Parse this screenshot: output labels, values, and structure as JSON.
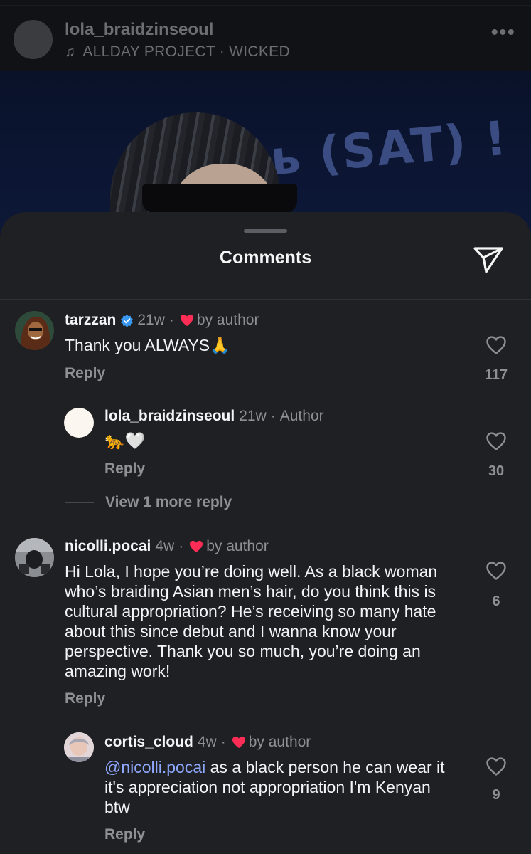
{
  "post": {
    "username": "lola_braidzinseoul",
    "music": "ALLDAY PROJECT · WICKED",
    "image_overlay_text": "ь (SAT) !"
  },
  "sheet": {
    "title": "Comments"
  },
  "comments": [
    {
      "username": "tarzzan",
      "verified": true,
      "time": "21w",
      "separator": "·",
      "liked_by": "by author",
      "text": "Thank you ALWAYS🙏",
      "reply": "Reply",
      "likes": "117",
      "replies": [
        {
          "username": "lola_braidzinseoul",
          "time": "21w",
          "separator": "·",
          "badge": "Author",
          "text": "🐆🤍",
          "reply": "Reply",
          "likes": "30"
        }
      ],
      "view_more": "View 1 more reply"
    },
    {
      "username": "nicolli.pocai",
      "time": "4w",
      "separator": "·",
      "liked_by": "by author",
      "text": "Hi Lola, I hope you’re doing well. As a black woman who’s braiding Asian men’s hair, do you think this is cultural appropriation? He’s receiving so many hate about this since debut and I wanna know your perspective. Thank you so much, you’re doing an amazing work!",
      "reply": "Reply",
      "likes": "6",
      "replies": [
        {
          "username": "cortis_cloud",
          "time": "4w",
          "separator": "·",
          "liked_by": "by author",
          "mention": "@nicolli.pocai",
          "text": " as a black person he can wear it it's appreciation not appropriation I'm Kenyan btw",
          "reply": "Reply",
          "likes": "9"
        }
      ]
    }
  ],
  "colors": {
    "sheet_bg": "#1f2023",
    "heart_red": "#ff2d55",
    "verified_blue": "#3897f0",
    "mention_blue": "#8fa7ff",
    "secondary_text": "#8d9095"
  },
  "icons": {
    "music": "music-note-icon",
    "more": "more-horizontal-icon",
    "share": "paper-plane-icon",
    "like": "heart-outline-icon",
    "liked_by_author": "heart-filled-icon",
    "verified": "verified-badge-icon"
  }
}
